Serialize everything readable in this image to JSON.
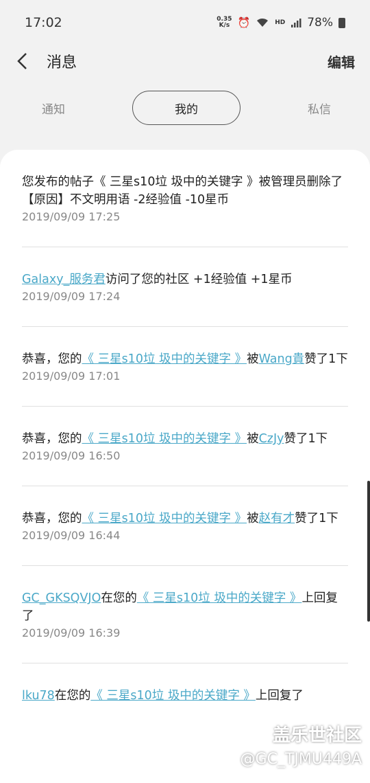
{
  "status_bar": {
    "time": "17:02",
    "net_speed_top": "0.35",
    "net_speed_bottom": "K/s",
    "hd_label": "HD",
    "battery": "78%"
  },
  "header": {
    "title": "消息",
    "edit_label": "编辑"
  },
  "tabs": [
    {
      "label": "通知"
    },
    {
      "label": "我的"
    },
    {
      "label": "私信"
    }
  ],
  "messages": [
    {
      "parts": [
        "您发布的帖子《 三星s10垃 圾中的关键字 》被管理员删除了 【原因】不文明用语 -2经验值 -10星币"
      ],
      "time": "2019/09/09 17:25"
    },
    {
      "user": "Galaxy_服务君",
      "text": "访问了您的社区 +1经验值 +1星币",
      "time": "2019/09/09 17:24"
    },
    {
      "prefix": "恭喜，您的",
      "post": "《 三星s10垃 圾中的关键字 》",
      "mid": "被",
      "user": "Wang貴",
      "suffix": "赞了1下",
      "time": "2019/09/09 17:01"
    },
    {
      "prefix": "恭喜，您的",
      "post": "《 三星s10垃 圾中的关键字 》",
      "mid": "被",
      "user": "CzJy",
      "suffix": "赞了1下",
      "time": "2019/09/09 16:50"
    },
    {
      "prefix": "恭喜，您的",
      "post": "《 三星s10垃 圾中的关键字 》",
      "mid": "被",
      "user": "赵有才",
      "suffix": "赞了1下",
      "time": "2019/09/09 16:44"
    },
    {
      "user": "GC_GKSQVJO",
      "mid": "在您的",
      "post": "《 三星s10垃 圾中的关键字 》",
      "suffix": "上回复了",
      "time": "2019/09/09 16:39"
    },
    {
      "user": "lku78",
      "mid": "在您的",
      "post": "《 三星s10垃 圾中的关键字 》",
      "suffix": "上回复了"
    }
  ],
  "watermark": {
    "line1": "盖乐世社区",
    "line2": "@GC_TJMU449A"
  },
  "colors": {
    "link": "#4aa8c8",
    "background": "#f2f2f2"
  }
}
